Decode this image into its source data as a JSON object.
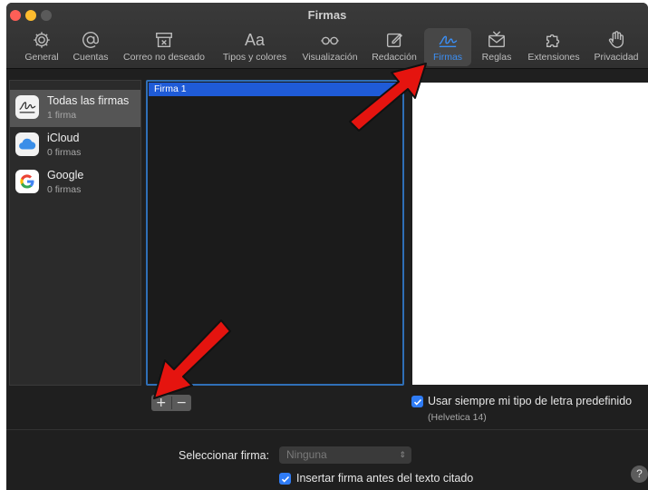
{
  "window": {
    "title": "Firmas"
  },
  "toolbar": {
    "items": [
      {
        "label": "General",
        "icon": "gear-icon"
      },
      {
        "label": "Cuentas",
        "icon": "at-sign-icon"
      },
      {
        "label": "Correo no deseado",
        "icon": "junk-mail-icon"
      },
      {
        "label": "Tipos y colores",
        "icon": "font-icon",
        "glyph": "Aa"
      },
      {
        "label": "Visualización",
        "icon": "glasses-icon"
      },
      {
        "label": "Redacción",
        "icon": "compose-icon"
      },
      {
        "label": "Firmas",
        "icon": "signature-icon",
        "active": true
      },
      {
        "label": "Reglas",
        "icon": "rules-envelope-icon"
      },
      {
        "label": "Extensiones",
        "icon": "puzzle-icon"
      },
      {
        "label": "Privacidad",
        "icon": "hand-icon"
      }
    ]
  },
  "accounts": [
    {
      "name": "Todas las firmas",
      "count": "1 firma",
      "icon": "signature-icon",
      "selected": true
    },
    {
      "name": "iCloud",
      "count": "0 firmas",
      "icon": "icloud-icon"
    },
    {
      "name": "Google",
      "count": "0 firmas",
      "icon": "google-icon"
    }
  ],
  "signatures": [
    {
      "name": "Firma 1"
    }
  ],
  "buttons": {
    "add": "+",
    "remove": "−"
  },
  "options": {
    "default_font": {
      "label": "Usar siempre mi tipo de letra predefinido",
      "checked": true,
      "sub": "(Helvetica 14)"
    },
    "select_signature": {
      "label": "Seleccionar firma:",
      "value": "Ninguna"
    },
    "insert_before": {
      "label": "Insertar firma antes del texto citado",
      "checked": true
    }
  },
  "help": {
    "label": "?"
  },
  "colors": {
    "accent": "#2f7cf6",
    "annotation_arrow": "#e5140f"
  }
}
